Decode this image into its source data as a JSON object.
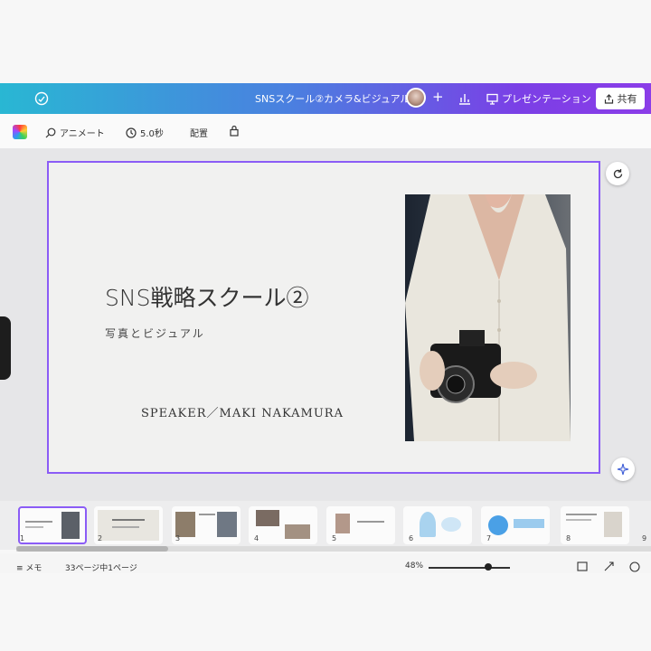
{
  "topbar": {
    "document_title": "SNSスクール②カメラ&ビジュアル",
    "add_label": "+",
    "present_label": "プレゼンテーション",
    "share_label": "共有"
  },
  "toolbar": {
    "animate_label": "アニメート",
    "duration_label": "5.0秒",
    "arrange_label": "配置"
  },
  "slide": {
    "title": "SNS戦略スクール②",
    "subtitle": "写真とビジュアル",
    "speaker": "SPEAKER／MAKI NAKAMURA"
  },
  "thumbnails": [
    {
      "number": "1"
    },
    {
      "number": "2"
    },
    {
      "number": "3"
    },
    {
      "number": "4"
    },
    {
      "number": "5"
    },
    {
      "number": "6"
    },
    {
      "number": "7"
    },
    {
      "number": "8"
    },
    {
      "number": "9"
    }
  ],
  "bottombar": {
    "notes_label": "メモ",
    "pages_label": "33ページ中1ページ",
    "zoom_label": "48%"
  },
  "colors": {
    "accent": "#8b5cf6",
    "gradient_start": "#29b7d3",
    "gradient_end": "#8b3de8"
  }
}
